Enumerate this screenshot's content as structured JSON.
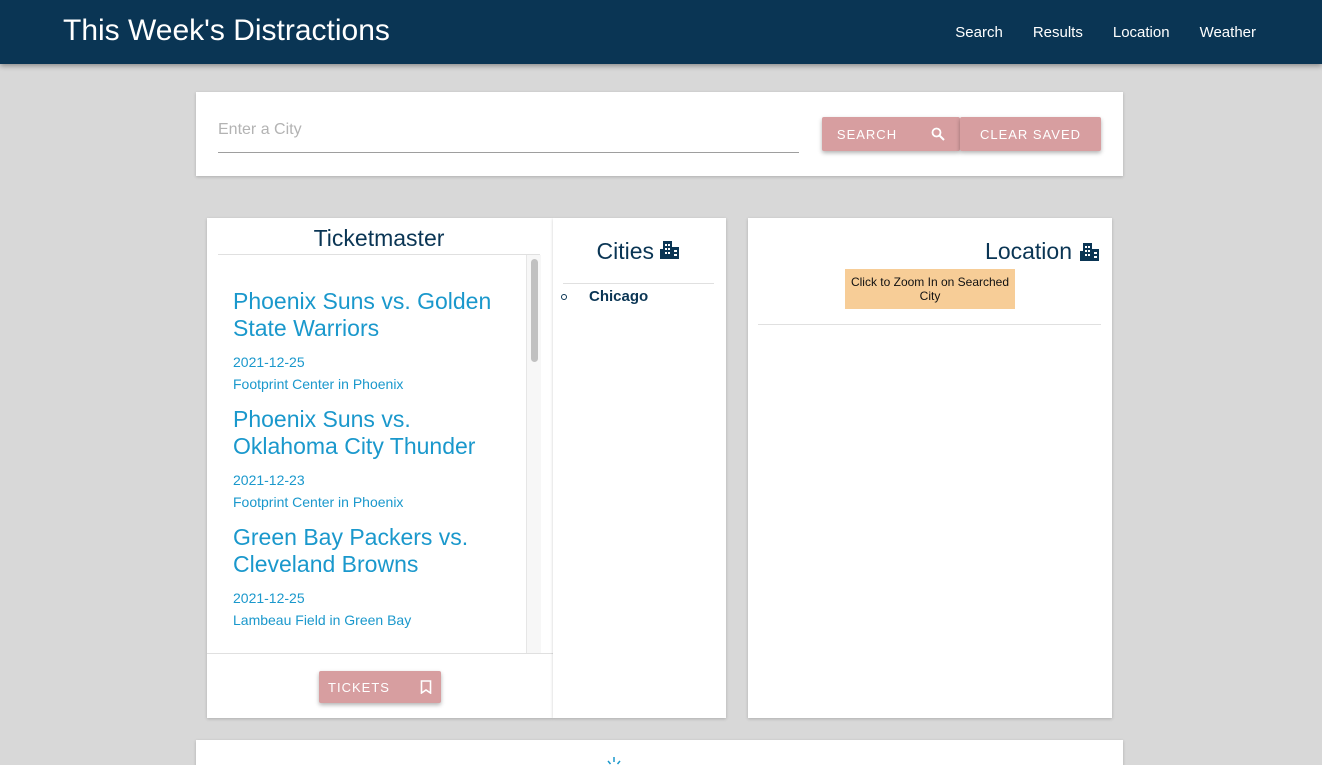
{
  "nav": {
    "brand": "This Week's Distractions",
    "links": [
      "Search",
      "Results",
      "Location",
      "Weather"
    ]
  },
  "search": {
    "placeholder": "Enter a City",
    "value": "",
    "search_label": "SEARCH",
    "clear_label": "CLEAR SAVED"
  },
  "ticketmaster": {
    "title": "Ticketmaster",
    "events": [
      {
        "title": "Phoenix Suns vs. Golden State Warriors",
        "date": "2021-12-25",
        "venue": "Footprint Center in Phoenix"
      },
      {
        "title": "Phoenix Suns vs. Oklahoma City Thunder",
        "date": "2021-12-23",
        "venue": "Footprint Center in Phoenix"
      },
      {
        "title": "Green Bay Packers vs. Cleveland Browns",
        "date": "2021-12-25",
        "venue": "Lambeau Field in Green Bay"
      }
    ],
    "tickets_label": "TICKETS"
  },
  "cities": {
    "title": "Cities",
    "items": [
      "Chicago"
    ]
  },
  "location": {
    "title": "Location",
    "zoom_label": "Click to Zoom In on Searched City"
  },
  "icons": {
    "search": "search-icon",
    "city": "city-icon",
    "bookmark": "bookmark-icon",
    "weather": "sun-icon"
  },
  "colors": {
    "navbar": "#0a3554",
    "button": "#d79ea0",
    "event_link": "#1a98cc",
    "zoom_button": "#f7cd97"
  }
}
